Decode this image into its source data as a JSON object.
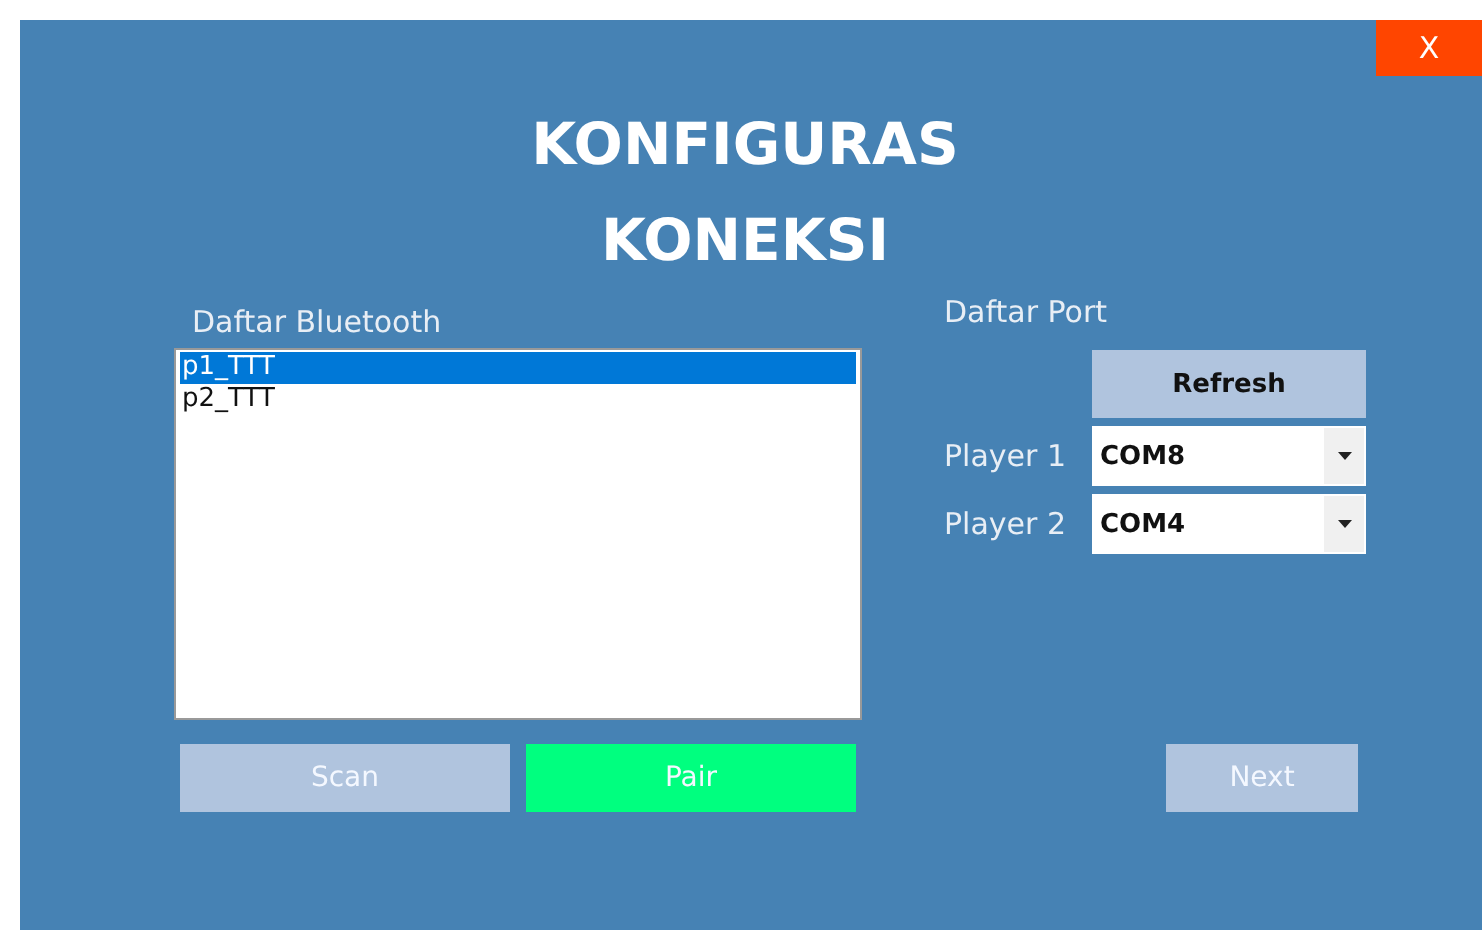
{
  "window": {
    "close": "X",
    "title_lines": [
      "KONFIGURAS",
      "KONEKSI"
    ]
  },
  "bluetooth": {
    "label": "Daftar Bluetooth",
    "items": [
      {
        "label": "p1_TTT",
        "selected": true
      },
      {
        "label": "p2_TTT",
        "selected": false
      }
    ]
  },
  "port": {
    "label": "Daftar Port",
    "refresh": {
      "label": "Refresh",
      "disabled": false
    },
    "players": [
      {
        "label": "Player 1",
        "value": "COM8"
      },
      {
        "label": "Player 2",
        "value": "COM4"
      }
    ]
  },
  "buttons": [
    {
      "label": "Scan",
      "kind": "normal",
      "disabled": true
    },
    {
      "label": "Pair",
      "kind": "primary",
      "disabled": true
    },
    {
      "label": "Next",
      "kind": "normal",
      "disabled": true
    }
  ]
}
